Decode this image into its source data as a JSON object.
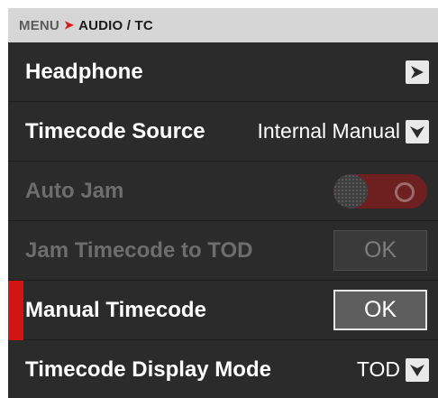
{
  "breadcrumb": {
    "parent": "MENU",
    "separator": "➤",
    "current": "AUDIO / TC"
  },
  "rows": {
    "headphone": {
      "label": "Headphone",
      "icon": "chevron-right-icon"
    },
    "timecode_source": {
      "label": "Timecode Source",
      "value": "Internal Manual",
      "icon": "chevron-down-icon"
    },
    "auto_jam": {
      "label": "Auto Jam",
      "state": "disabled",
      "toggle_on": false
    },
    "jam_tod": {
      "label": "Jam Timecode to TOD",
      "button": "OK",
      "state": "disabled"
    },
    "manual_timecode": {
      "label": "Manual Timecode",
      "button": "OK",
      "focused": true
    },
    "display_mode": {
      "label": "Timecode Display Mode",
      "value": "TOD",
      "icon": "chevron-down-icon"
    }
  },
  "colors": {
    "panel_bg": "#2b2b2b",
    "header_bg": "#d6d6d6",
    "accent_red": "#d11515",
    "toggle_track": "#6e1f1f"
  }
}
